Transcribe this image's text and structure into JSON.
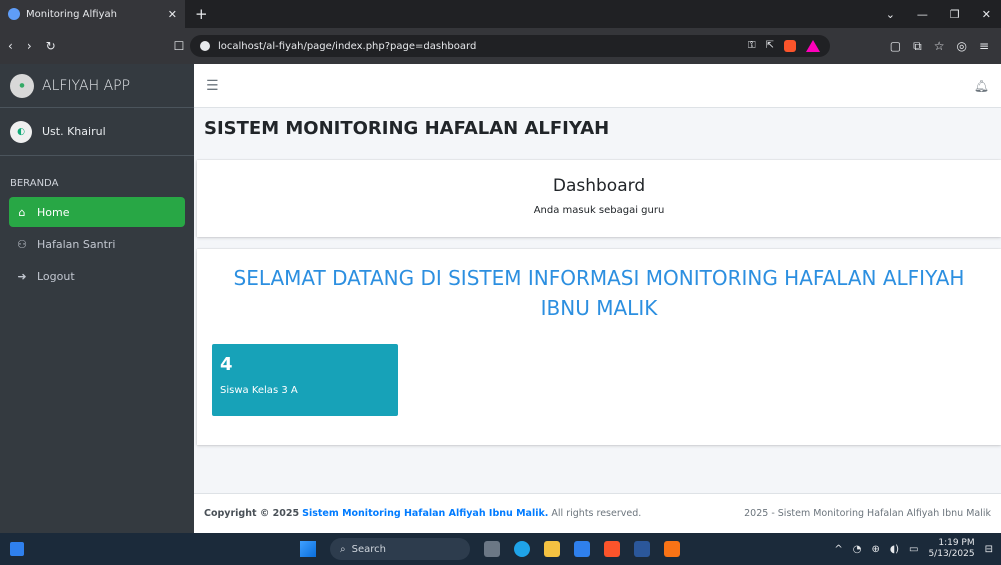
{
  "browser": {
    "tab_title": "Monitoring Alfiyah",
    "url": "localhost/al-fiyah/page/index.php?page=dashboard"
  },
  "sidebar": {
    "brand": "ALFIYAH APP",
    "user": "Ust. Khairul",
    "header": "BERANDA",
    "items": [
      {
        "label": "Home",
        "icon": "home-icon",
        "active": true
      },
      {
        "label": "Hafalan Santri",
        "icon": "users-icon",
        "active": false
      },
      {
        "label": "Logout",
        "icon": "logout-icon",
        "active": false
      }
    ]
  },
  "main": {
    "page_title": "SISTEM MONITORING HAFALAN ALFIYAH",
    "dashboard_title": "Dashboard",
    "dashboard_sub": "Anda masuk sebagai guru",
    "welcome": "SELAMAT DATANG DI SISTEM INFORMASI MONITORING HAFALAN ALFIYAH IBNU MALIK",
    "stat": {
      "value": "4",
      "label": "Siswa Kelas 3 A"
    }
  },
  "footer": {
    "copyright_prefix": "Copyright © 2025",
    "copyright_link": "Sistem Monitoring Hafalan Alfiyah Ibnu Malik.",
    "copyright_suffix": "All rights reserved.",
    "right_text": "2025 - Sistem Monitoring Hafalan Alfiyah Ibnu Malik"
  },
  "taskbar": {
    "search_placeholder": "Search",
    "time": "1:19 PM",
    "date": "5/13/2025"
  },
  "colors": {
    "sidebar_bg": "#343a40",
    "active_green": "#28a745",
    "info_teal": "#17a2b8",
    "welcome_blue": "#2c8fe0",
    "link_blue": "#007bff"
  }
}
